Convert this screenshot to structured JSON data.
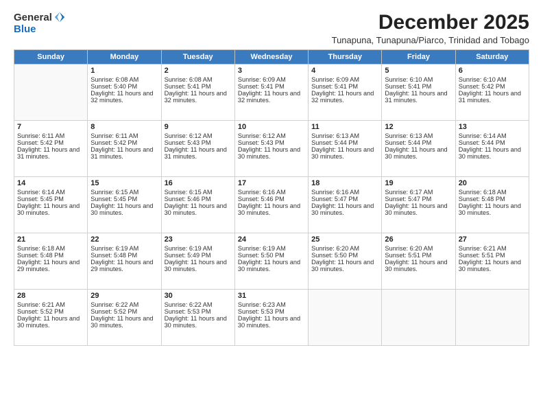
{
  "logo": {
    "general": "General",
    "blue": "Blue"
  },
  "title": "December 2025",
  "subtitle": "Tunapuna, Tunapuna/Piarco, Trinidad and Tobago",
  "days_of_week": [
    "Sunday",
    "Monday",
    "Tuesday",
    "Wednesday",
    "Thursday",
    "Friday",
    "Saturday"
  ],
  "weeks": [
    [
      {
        "day": "",
        "sunrise": "",
        "sunset": "",
        "daylight": ""
      },
      {
        "day": "1",
        "sunrise": "Sunrise: 6:08 AM",
        "sunset": "Sunset: 5:40 PM",
        "daylight": "Daylight: 11 hours and 32 minutes."
      },
      {
        "day": "2",
        "sunrise": "Sunrise: 6:08 AM",
        "sunset": "Sunset: 5:41 PM",
        "daylight": "Daylight: 11 hours and 32 minutes."
      },
      {
        "day": "3",
        "sunrise": "Sunrise: 6:09 AM",
        "sunset": "Sunset: 5:41 PM",
        "daylight": "Daylight: 11 hours and 32 minutes."
      },
      {
        "day": "4",
        "sunrise": "Sunrise: 6:09 AM",
        "sunset": "Sunset: 5:41 PM",
        "daylight": "Daylight: 11 hours and 32 minutes."
      },
      {
        "day": "5",
        "sunrise": "Sunrise: 6:10 AM",
        "sunset": "Sunset: 5:41 PM",
        "daylight": "Daylight: 11 hours and 31 minutes."
      },
      {
        "day": "6",
        "sunrise": "Sunrise: 6:10 AM",
        "sunset": "Sunset: 5:42 PM",
        "daylight": "Daylight: 11 hours and 31 minutes."
      }
    ],
    [
      {
        "day": "7",
        "sunrise": "Sunrise: 6:11 AM",
        "sunset": "Sunset: 5:42 PM",
        "daylight": "Daylight: 11 hours and 31 minutes."
      },
      {
        "day": "8",
        "sunrise": "Sunrise: 6:11 AM",
        "sunset": "Sunset: 5:42 PM",
        "daylight": "Daylight: 11 hours and 31 minutes."
      },
      {
        "day": "9",
        "sunrise": "Sunrise: 6:12 AM",
        "sunset": "Sunset: 5:43 PM",
        "daylight": "Daylight: 11 hours and 31 minutes."
      },
      {
        "day": "10",
        "sunrise": "Sunrise: 6:12 AM",
        "sunset": "Sunset: 5:43 PM",
        "daylight": "Daylight: 11 hours and 30 minutes."
      },
      {
        "day": "11",
        "sunrise": "Sunrise: 6:13 AM",
        "sunset": "Sunset: 5:44 PM",
        "daylight": "Daylight: 11 hours and 30 minutes."
      },
      {
        "day": "12",
        "sunrise": "Sunrise: 6:13 AM",
        "sunset": "Sunset: 5:44 PM",
        "daylight": "Daylight: 11 hours and 30 minutes."
      },
      {
        "day": "13",
        "sunrise": "Sunrise: 6:14 AM",
        "sunset": "Sunset: 5:44 PM",
        "daylight": "Daylight: 11 hours and 30 minutes."
      }
    ],
    [
      {
        "day": "14",
        "sunrise": "Sunrise: 6:14 AM",
        "sunset": "Sunset: 5:45 PM",
        "daylight": "Daylight: 11 hours and 30 minutes."
      },
      {
        "day": "15",
        "sunrise": "Sunrise: 6:15 AM",
        "sunset": "Sunset: 5:45 PM",
        "daylight": "Daylight: 11 hours and 30 minutes."
      },
      {
        "day": "16",
        "sunrise": "Sunrise: 6:15 AM",
        "sunset": "Sunset: 5:46 PM",
        "daylight": "Daylight: 11 hours and 30 minutes."
      },
      {
        "day": "17",
        "sunrise": "Sunrise: 6:16 AM",
        "sunset": "Sunset: 5:46 PM",
        "daylight": "Daylight: 11 hours and 30 minutes."
      },
      {
        "day": "18",
        "sunrise": "Sunrise: 6:16 AM",
        "sunset": "Sunset: 5:47 PM",
        "daylight": "Daylight: 11 hours and 30 minutes."
      },
      {
        "day": "19",
        "sunrise": "Sunrise: 6:17 AM",
        "sunset": "Sunset: 5:47 PM",
        "daylight": "Daylight: 11 hours and 30 minutes."
      },
      {
        "day": "20",
        "sunrise": "Sunrise: 6:18 AM",
        "sunset": "Sunset: 5:48 PM",
        "daylight": "Daylight: 11 hours and 30 minutes."
      }
    ],
    [
      {
        "day": "21",
        "sunrise": "Sunrise: 6:18 AM",
        "sunset": "Sunset: 5:48 PM",
        "daylight": "Daylight: 11 hours and 29 minutes."
      },
      {
        "day": "22",
        "sunrise": "Sunrise: 6:19 AM",
        "sunset": "Sunset: 5:48 PM",
        "daylight": "Daylight: 11 hours and 29 minutes."
      },
      {
        "day": "23",
        "sunrise": "Sunrise: 6:19 AM",
        "sunset": "Sunset: 5:49 PM",
        "daylight": "Daylight: 11 hours and 30 minutes."
      },
      {
        "day": "24",
        "sunrise": "Sunrise: 6:19 AM",
        "sunset": "Sunset: 5:50 PM",
        "daylight": "Daylight: 11 hours and 30 minutes."
      },
      {
        "day": "25",
        "sunrise": "Sunrise: 6:20 AM",
        "sunset": "Sunset: 5:50 PM",
        "daylight": "Daylight: 11 hours and 30 minutes."
      },
      {
        "day": "26",
        "sunrise": "Sunrise: 6:20 AM",
        "sunset": "Sunset: 5:51 PM",
        "daylight": "Daylight: 11 hours and 30 minutes."
      },
      {
        "day": "27",
        "sunrise": "Sunrise: 6:21 AM",
        "sunset": "Sunset: 5:51 PM",
        "daylight": "Daylight: 11 hours and 30 minutes."
      }
    ],
    [
      {
        "day": "28",
        "sunrise": "Sunrise: 6:21 AM",
        "sunset": "Sunset: 5:52 PM",
        "daylight": "Daylight: 11 hours and 30 minutes."
      },
      {
        "day": "29",
        "sunrise": "Sunrise: 6:22 AM",
        "sunset": "Sunset: 5:52 PM",
        "daylight": "Daylight: 11 hours and 30 minutes."
      },
      {
        "day": "30",
        "sunrise": "Sunrise: 6:22 AM",
        "sunset": "Sunset: 5:53 PM",
        "daylight": "Daylight: 11 hours and 30 minutes."
      },
      {
        "day": "31",
        "sunrise": "Sunrise: 6:23 AM",
        "sunset": "Sunset: 5:53 PM",
        "daylight": "Daylight: 11 hours and 30 minutes."
      },
      {
        "day": "",
        "sunrise": "",
        "sunset": "",
        "daylight": ""
      },
      {
        "day": "",
        "sunrise": "",
        "sunset": "",
        "daylight": ""
      },
      {
        "day": "",
        "sunrise": "",
        "sunset": "",
        "daylight": ""
      }
    ]
  ]
}
